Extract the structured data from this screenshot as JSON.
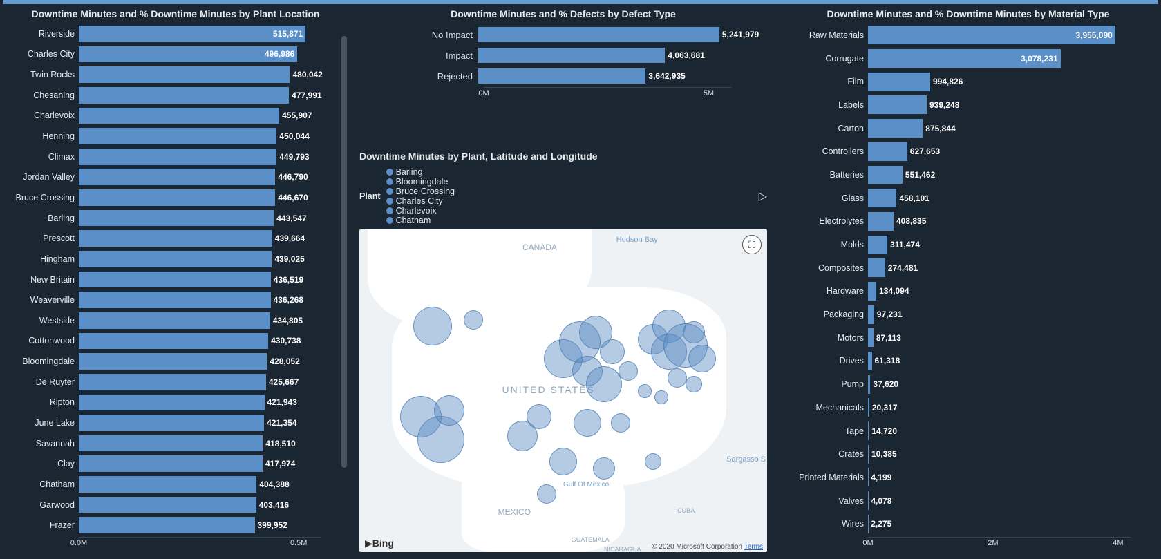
{
  "colors": {
    "bar": "#5a8fc7",
    "bg": "#1a2632"
  },
  "chart_data": [
    {
      "id": "plant",
      "type": "bar",
      "orientation": "horizontal",
      "title": "Downtime Minutes and % Downtime Minutes by Plant Location",
      "xlabel": "",
      "ylabel": "",
      "xlim": [
        0,
        550000
      ],
      "x_ticks": [
        {
          "v": 0,
          "label": "0.0M"
        },
        {
          "v": 500000,
          "label": "0.5M"
        }
      ],
      "categories": [
        "Riverside",
        "Charles City",
        "Twin Rocks",
        "Chesaning",
        "Charlevoix",
        "Henning",
        "Climax",
        "Jordan Valley",
        "Bruce Crossing",
        "Barling",
        "Prescott",
        "Hingham",
        "New Britain",
        "Weaverville",
        "Westside",
        "Cottonwood",
        "Bloomingdale",
        "De Ruyter",
        "Ripton",
        "June Lake",
        "Savannah",
        "Clay",
        "Chatham",
        "Garwood",
        "Frazer"
      ],
      "values": [
        515871,
        496986,
        480042,
        477991,
        455907,
        450044,
        449793,
        446790,
        446670,
        443547,
        439664,
        439025,
        436519,
        436268,
        434805,
        430738,
        428052,
        425667,
        421943,
        421354,
        418510,
        417974,
        404388,
        403416,
        399952
      ],
      "label_placement_threshold": 490000,
      "scrollable": true
    },
    {
      "id": "defect",
      "type": "bar",
      "orientation": "horizontal",
      "title": "Downtime Minutes and % Defects by Defect Type",
      "xlim": [
        0,
        5500000
      ],
      "x_ticks": [
        {
          "v": 0,
          "label": "0M"
        },
        {
          "v": 5000000,
          "label": "5M"
        }
      ],
      "categories": [
        "No Impact",
        "Impact",
        "Rejected"
      ],
      "values": [
        5241979,
        4063681,
        3642935
      ],
      "label_placement_threshold": 5500000
    },
    {
      "id": "material",
      "type": "bar",
      "orientation": "horizontal",
      "title": "Downtime Minutes and % Downtime Minutes by Material Type",
      "xlim": [
        0,
        4200000
      ],
      "x_ticks": [
        {
          "v": 0,
          "label": "0M"
        },
        {
          "v": 2000000,
          "label": "2M"
        },
        {
          "v": 4000000,
          "label": "4M"
        }
      ],
      "categories": [
        "Raw Materials",
        "Corrugate",
        "Film",
        "Labels",
        "Carton",
        "Controllers",
        "Batteries",
        "Glass",
        "Electrolytes",
        "Molds",
        "Composites",
        "Hardware",
        "Packaging",
        "Motors",
        "Drives",
        "Pump",
        "Mechanicals",
        "Tape",
        "Crates",
        "Printed Materials",
        "Valves",
        "Wires"
      ],
      "values": [
        3955090,
        3078231,
        994826,
        939248,
        875844,
        627653,
        551462,
        458101,
        408835,
        311474,
        274481,
        134094,
        97231,
        87113,
        61318,
        37620,
        20317,
        14720,
        10385,
        4199,
        4078,
        2275
      ],
      "label_placement_threshold": 3000000
    }
  ],
  "map": {
    "title": "Downtime Minutes by Plant, Latitude and Longitude",
    "legend_label": "Plant",
    "legend_items": [
      "Barling",
      "Bloomingdale",
      "Bruce Crossing",
      "Charles City",
      "Charlevoix",
      "Chatham"
    ],
    "labels": {
      "canada": "CANADA",
      "usa": "UNITED STATES",
      "mexico": "MEXICO",
      "gulf": "Gulf Of Mexico",
      "hudson": "Hudson Bay",
      "sargasso": "Sargasso S",
      "guatemala": "GUATEMALA",
      "nicaragua": "NICARAGUA",
      "cuba": "CUBA"
    },
    "attribution": "© 2020 Microsoft Corporation",
    "attribution_link": "Terms",
    "provider": "Bing",
    "bubbles": [
      {
        "x": 18,
        "y": 30,
        "r": 28
      },
      {
        "x": 28,
        "y": 28,
        "r": 14
      },
      {
        "x": 15,
        "y": 58,
        "r": 30
      },
      {
        "x": 20,
        "y": 65,
        "r": 34
      },
      {
        "x": 22,
        "y": 56,
        "r": 22
      },
      {
        "x": 40,
        "y": 64,
        "r": 22
      },
      {
        "x": 44,
        "y": 58,
        "r": 18
      },
      {
        "x": 50,
        "y": 40,
        "r": 28
      },
      {
        "x": 54,
        "y": 35,
        "r": 30
      },
      {
        "x": 56,
        "y": 44,
        "r": 22
      },
      {
        "x": 58,
        "y": 32,
        "r": 24
      },
      {
        "x": 62,
        "y": 38,
        "r": 18
      },
      {
        "x": 60,
        "y": 48,
        "r": 26
      },
      {
        "x": 56,
        "y": 60,
        "r": 20
      },
      {
        "x": 50,
        "y": 72,
        "r": 20
      },
      {
        "x": 60,
        "y": 74,
        "r": 16
      },
      {
        "x": 66,
        "y": 44,
        "r": 14
      },
      {
        "x": 70,
        "y": 50,
        "r": 10
      },
      {
        "x": 64,
        "y": 60,
        "r": 14
      },
      {
        "x": 72,
        "y": 34,
        "r": 22
      },
      {
        "x": 76,
        "y": 30,
        "r": 24
      },
      {
        "x": 76,
        "y": 38,
        "r": 26
      },
      {
        "x": 80,
        "y": 36,
        "r": 32
      },
      {
        "x": 84,
        "y": 40,
        "r": 20
      },
      {
        "x": 82,
        "y": 32,
        "r": 16
      },
      {
        "x": 78,
        "y": 46,
        "r": 14
      },
      {
        "x": 82,
        "y": 48,
        "r": 12
      },
      {
        "x": 74,
        "y": 52,
        "r": 10
      },
      {
        "x": 46,
        "y": 82,
        "r": 14
      },
      {
        "x": 72,
        "y": 72,
        "r": 12
      }
    ]
  }
}
